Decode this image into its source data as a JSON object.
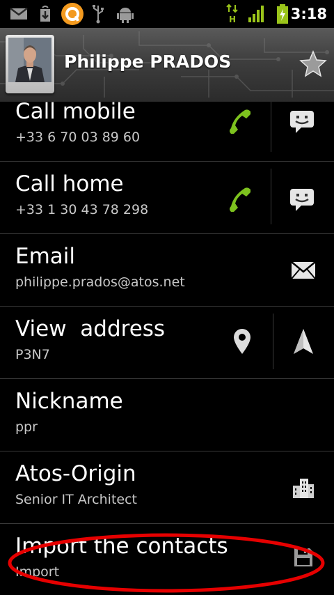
{
  "status_bar": {
    "time": "3:18",
    "icons": [
      "gmail-icon",
      "download-icon",
      "app-notification-icon",
      "usb-icon",
      "android-debug-icon",
      "hsdpa-data-icon",
      "signal-icon",
      "battery-charging-icon"
    ]
  },
  "contact": {
    "name": "Philippe PRADOS",
    "starred": false
  },
  "rows": [
    {
      "title": "Call mobile",
      "subtitle": "+33 6 70 03 89 60",
      "primary_icon": "phone-icon",
      "secondary_icon": "sms-icon"
    },
    {
      "title": "Call home",
      "subtitle": "+33 1 30 43 78 298",
      "primary_icon": "phone-icon",
      "secondary_icon": "sms-icon"
    },
    {
      "title": "Email",
      "subtitle": "philippe.prados@atos.net",
      "primary_icon": "envelope-icon"
    },
    {
      "title": "View  address",
      "subtitle": "P3N7",
      "primary_icon": "map-pin-icon",
      "secondary_icon": "navigation-arrow-icon"
    },
    {
      "title": "Nickname",
      "subtitle": "ppr"
    },
    {
      "title": "Atos-Origin",
      "subtitle": "Senior IT Architect",
      "primary_icon": "building-icon"
    },
    {
      "title": "Import the contacts",
      "subtitle": "Import",
      "primary_icon": "save-disk-icon"
    }
  ],
  "colors": {
    "phone_green": "#7dc21e",
    "highlight_red": "#e60000",
    "icon_gray": "#d9d9d9"
  }
}
